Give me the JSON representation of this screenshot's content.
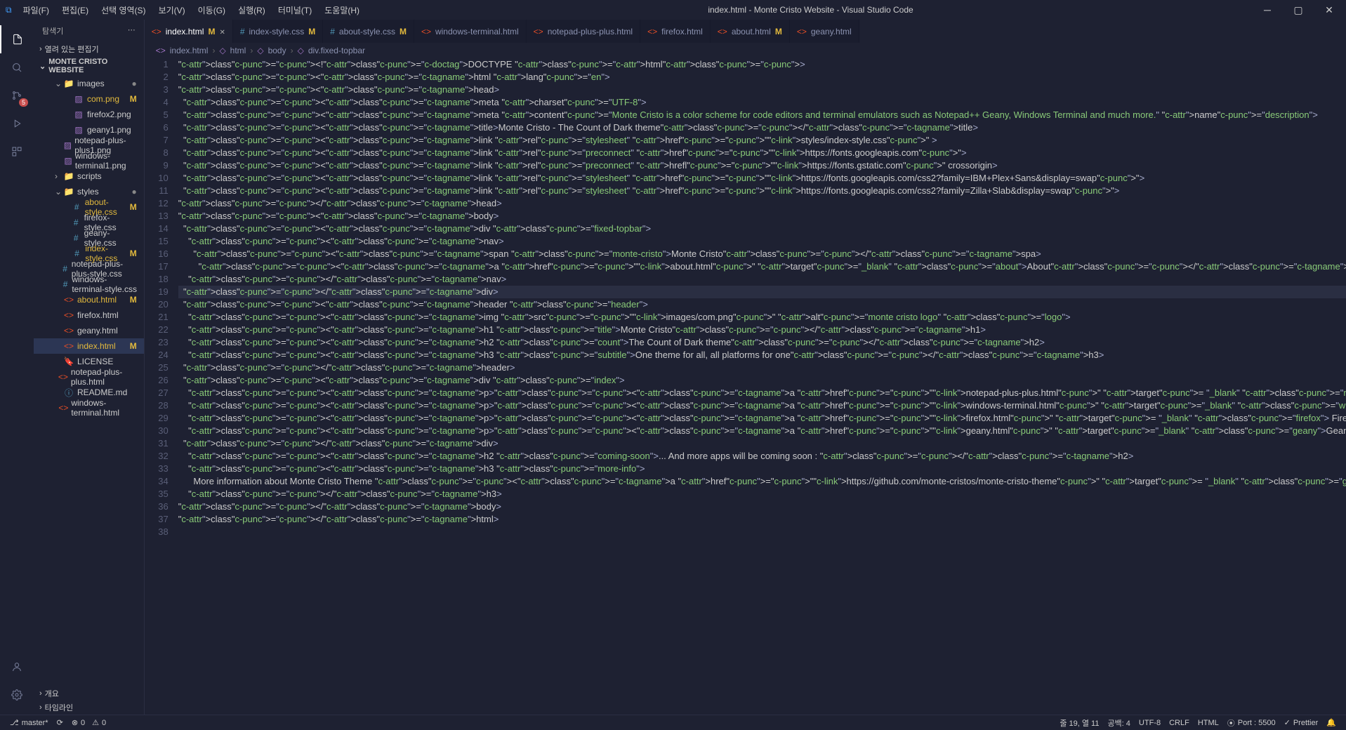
{
  "window": {
    "title": "index.html - Monte Cristo Website - Visual Studio Code"
  },
  "menu": [
    "파일(F)",
    "편집(E)",
    "선택 영역(S)",
    "보기(V)",
    "이동(G)",
    "실행(R)",
    "터미널(T)",
    "도움말(H)"
  ],
  "sidebar": {
    "title": "탐색기",
    "open_editors": "열려 있는 편집기",
    "project": "MONTE CRISTO WEBSITE",
    "outline": "개요",
    "timeline": "타임라인",
    "items": [
      {
        "name": "images",
        "type": "folder",
        "depth": 1,
        "open": true,
        "dot": true
      },
      {
        "name": "com.png",
        "type": "img",
        "depth": 2,
        "mod": true
      },
      {
        "name": "firefox2.png",
        "type": "img",
        "depth": 2
      },
      {
        "name": "geany1.png",
        "type": "img",
        "depth": 2
      },
      {
        "name": "notepad-plus-plus1.png",
        "type": "img",
        "depth": 2
      },
      {
        "name": "windows-terminal1.png",
        "type": "img",
        "depth": 2
      },
      {
        "name": "scripts",
        "type": "folder",
        "depth": 1,
        "open": false
      },
      {
        "name": "styles",
        "type": "folder",
        "depth": 1,
        "open": true,
        "dot": true
      },
      {
        "name": "about-style.css",
        "type": "css",
        "depth": 2,
        "mod": true
      },
      {
        "name": "firefox-style.css",
        "type": "css",
        "depth": 2
      },
      {
        "name": "geany-style.css",
        "type": "css",
        "depth": 2
      },
      {
        "name": "index-style.css",
        "type": "css",
        "depth": 2,
        "mod": true
      },
      {
        "name": "notepad-plus-plus-style.css",
        "type": "css",
        "depth": 2
      },
      {
        "name": "windows-terminal-style.css",
        "type": "css",
        "depth": 2
      },
      {
        "name": "about.html",
        "type": "html",
        "depth": 1,
        "mod": true
      },
      {
        "name": "firefox.html",
        "type": "html",
        "depth": 1
      },
      {
        "name": "geany.html",
        "type": "html",
        "depth": 1
      },
      {
        "name": "index.html",
        "type": "html",
        "depth": 1,
        "mod": true,
        "selected": true
      },
      {
        "name": "LICENSE",
        "type": "cert",
        "depth": 1
      },
      {
        "name": "notepad-plus-plus.html",
        "type": "html",
        "depth": 1
      },
      {
        "name": "README.md",
        "type": "md",
        "depth": 1
      },
      {
        "name": "windows-terminal.html",
        "type": "html",
        "depth": 1
      }
    ]
  },
  "tabs": [
    {
      "label": "index.html",
      "icon": "html",
      "mod": true,
      "active": true,
      "close": true
    },
    {
      "label": "index-style.css",
      "icon": "css",
      "mod": true
    },
    {
      "label": "about-style.css",
      "icon": "css",
      "mod": true
    },
    {
      "label": "windows-terminal.html",
      "icon": "html"
    },
    {
      "label": "notepad-plus-plus.html",
      "icon": "html"
    },
    {
      "label": "firefox.html",
      "icon": "html"
    },
    {
      "label": "about.html",
      "icon": "html",
      "mod": true
    },
    {
      "label": "geany.html",
      "icon": "html"
    }
  ],
  "breadcrumb": [
    "index.html",
    "html",
    "body",
    "div.fixed-topbar"
  ],
  "status": {
    "branch": "master*",
    "errors": "0",
    "warnings": "0",
    "lncol": "줄 19, 열 11",
    "spaces": "공백: 4",
    "encoding": "UTF-8",
    "eol": "CRLF",
    "lang": "HTML",
    "port": "Port : 5500",
    "prettier": "Prettier"
  },
  "code": [
    "<!DOCTYPE html>",
    "<html lang=\"en\">",
    "<head>",
    "  <meta charset=\"UTF-8\">",
    "  <meta content=\"Monte Cristo is a color scheme for code editors and terminal emulators such as Notepad++ Geany, Windows Terminal and much more.\" name=\"description\">",
    "  <title>Monte Cristo - The Count of Dark theme</title>",
    "  <link rel=\"stylesheet\" href=\"styles/index-style.css\" >",
    "  <link rel=\"preconnect\" href=\"https://fonts.googleapis.com\">",
    "  <link rel=\"preconnect\" hrefl=\"https://fonts.gstatic.com\" crossorigin>",
    "  <link rel=\"stylesheet\" href=\"https://fonts.googleapis.com/css2?family=IBM+Plex+Sans&display=swap\">",
    "  <link rel=\"stylesheet\" href=\"https://fonts.googleapis.com/css2?family=Zilla+Slab&display=swap\">",
    "</head>",
    "<body>",
    "  <div class=\"fixed-topbar\">",
    "    <nav>",
    "      <span class=\"monte-cristo\">Monte Cristo</spa>",
    "        <a href=\"about.html\" target=\"_blank\" class=\"about\">About</a>",
    "    </nav>",
    "  </div>",
    "  <header class=\"header\">",
    "    <img src=\"images/com.png\" alt=\"monte cristo logo\" class=\"logo\">",
    "    <h1 class=\"title\">Monte Cristo</h1>",
    "    <h2 class=\"count\">The Count of Dark theme</h2>",
    "    <h3 class=\"subtitle\">One theme for all, all platforms for one</h3>",
    "  </header>",
    "  <div class=\"index\">",
    "    <p><a href=\"notepad-plus-plus.html\" target= \"_blank\" class=\"notepad-plus-plus\">Notepad++</a></p>",
    "    <p><a href=\"windows-terminal.html\" target=\"_blank\" class=\"windows-terminal\">Windows Terminal</a></p>",
    "    <p><a href=\"firefox.html\" target= \"_blank\" class=\"firefox\"> Firefox</a></p>",
    "    <p><a href=\"geany.html\" target=\"_blank\" class=\"geany\">Geany</a></p>",
    "  </div>",
    "    <h2 class=\"coming-soon\">... And more apps will be coming soon : </h2>",
    "    <h3 class=\"more-info\">",
    "      More information about Monte Cristo Theme <a href=\"https://github.com/monte-cristos/monte-cristo-theme\" target= \"_blank\" class=\"github-links\">in Github Pages.</a>",
    "    </h3>",
    "</body>",
    "</html>",
    ""
  ]
}
